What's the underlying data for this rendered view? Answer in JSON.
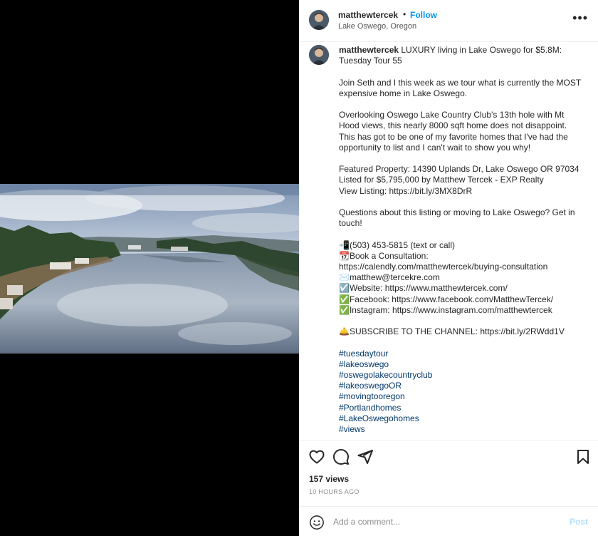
{
  "post": {
    "username": "matthewtercek",
    "separator": "•",
    "follow_label": "Follow",
    "location": "Lake Oswego, Oregon",
    "more_label": "•••"
  },
  "caption": {
    "username": "matthewtercek",
    "title": " LUXURY living in Lake Oswego for $5.8M:",
    "title2": "Tuesday Tour 55",
    "p2_l1": "Join Seth and I this week as we tour what is currently the MOST",
    "p2_l2": "expensive home in Lake Oswego.",
    "p3_l1": "Overlooking Oswego Lake Country Club's 13th hole with Mt",
    "p3_l2": "Hood views, this nearly 8000 sqft home does not disappoint.",
    "p3_l3": "This has got to be one of my favorite homes that I've had the",
    "p3_l4": "opportunity to list and I can't wait to show you why!",
    "p4_l1": "Featured Property: 14390 Uplands Dr, Lake Oswego OR 97034",
    "p4_l2": "Listed for $5,795,000 by Matthew Tercek - EXP Realty",
    "p4_l3": "View Listing: https://bit.ly/3MX8DrR",
    "p5_l1": "Questions about this listing or moving to Lake Oswego? Get in",
    "p5_l2": "touch!",
    "c1": "📲(503) 453-5815 (text or call)",
    "c2": "📆Book a Consultation:",
    "c3": "https://calendly.com/matthewtercek/buying-consultation",
    "c4": "✉️matthew@tercekre.com",
    "c5": "☑️Website: https://www.matthewtercek.com/",
    "c6": "✅Facebook: https://www.facebook.com/MatthewTercek/",
    "c7": "✅Instagram: https://www.instagram.com/matthewtercek",
    "subscribe": "🛎️SUBSCRIBE TO THE CHANNEL: https://bit.ly/2RWdd1V",
    "hashtags": [
      "#tuesdaytour",
      "#lakeoswego",
      "#oswegolakecountryclub",
      "#lakeoswegoOR",
      "#movingtooregon",
      "#Portlandhomes",
      "#LakeOswegohomes",
      "#views"
    ]
  },
  "stats": {
    "views": "157 views",
    "time_ago": "10 HOURS AGO"
  },
  "comment_box": {
    "placeholder": "Add a comment...",
    "post_label": "Post"
  },
  "icons": {
    "like": "heart-icon",
    "comment": "comment-icon",
    "share": "share-icon",
    "save": "bookmark-icon",
    "emoji": "emoji-icon",
    "more": "more-icon"
  },
  "colors": {
    "link": "#0095f6",
    "hashtag": "#00376b",
    "muted": "#8e8e8e",
    "post_disabled": "#b2dffc"
  }
}
